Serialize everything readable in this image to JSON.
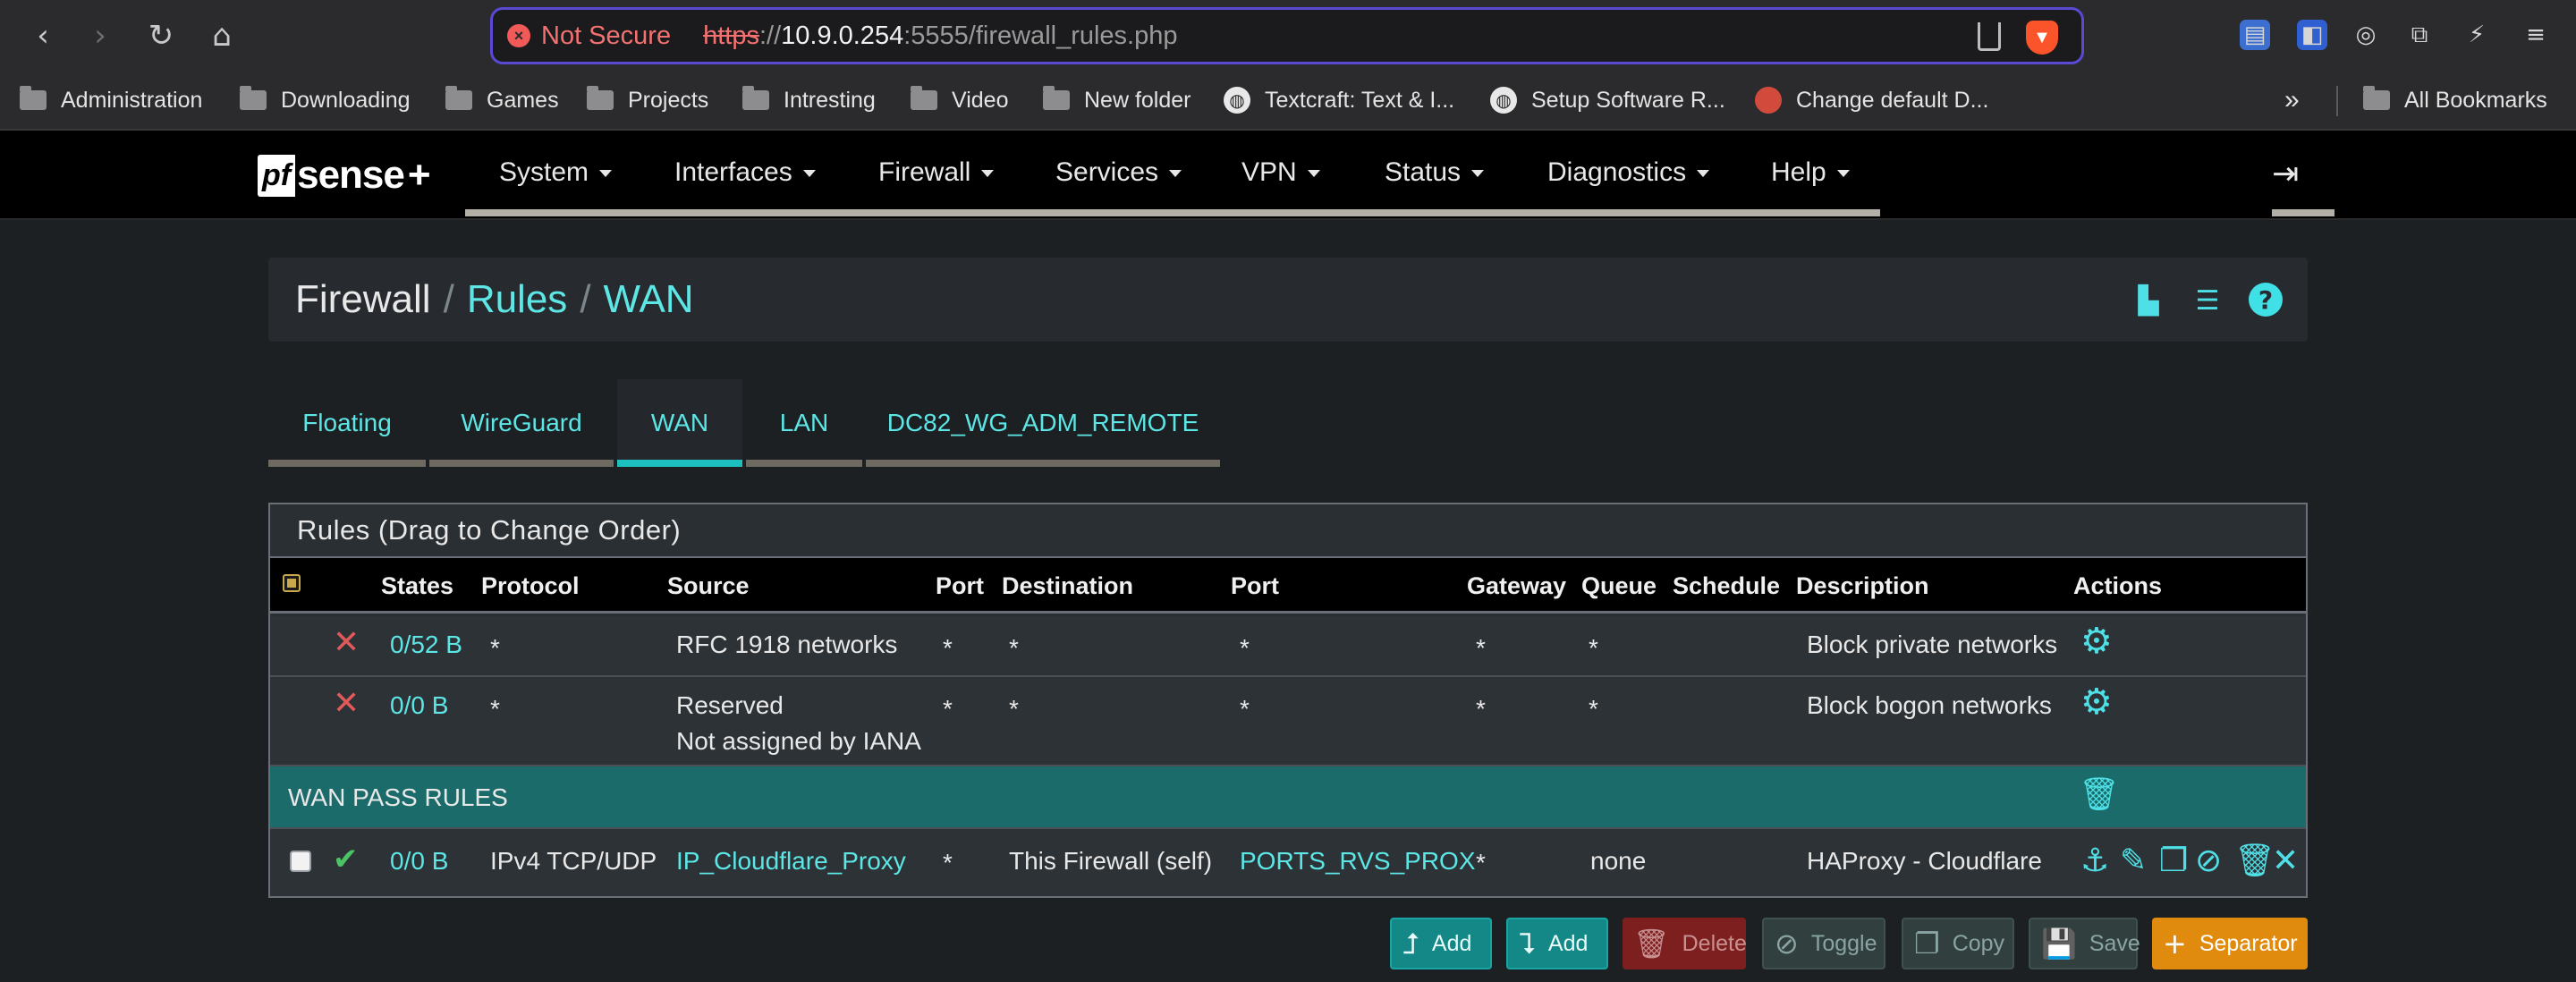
{
  "browser": {
    "security_label": "Not Secure",
    "url_scheme": "https",
    "url_sep": "://",
    "url_host": "10.9.0.254",
    "url_rest": ":5555/firewall_rules.php",
    "bookmarks": [
      "Administration",
      "Downloading",
      "Games",
      "Projects",
      "Intresting",
      "Video",
      "New folder",
      "Textcraft: Text & I...",
      "Setup Software R...",
      "Change default D...",
      "All Bookmarks"
    ],
    "bookmarks_more": "»"
  },
  "nav": {
    "logo_pf": "pf",
    "logo_sense": "sense",
    "logo_plus": "+",
    "menu": [
      "System",
      "Interfaces",
      "Firewall",
      "Services",
      "VPN",
      "Status",
      "Diagnostics",
      "Help"
    ]
  },
  "breadcrumb": {
    "root": "Firewall",
    "sep": "/",
    "level1": "Rules",
    "level2": "WAN"
  },
  "tabs": [
    "Floating",
    "WireGuard",
    "WAN",
    "LAN",
    "DC82_WG_ADM_REMOTE"
  ],
  "active_tab": "WAN",
  "panel": {
    "title": "Rules (Drag to Change Order)",
    "headers": [
      "States",
      "Protocol",
      "Source",
      "Port",
      "Destination",
      "Port",
      "Gateway",
      "Queue",
      "Schedule",
      "Description",
      "Actions"
    ]
  },
  "rules": [
    {
      "states": "0/52 B",
      "protocol": "*",
      "source": "RFC 1918 networks",
      "source2": "",
      "sport": "*",
      "dest": "*",
      "dport": "*",
      "gateway": "*",
      "queue": "*",
      "schedule": "",
      "description": "Block private networks"
    },
    {
      "states": "0/0 B",
      "protocol": "*",
      "source": "Reserved",
      "source2": "Not assigned by IANA",
      "sport": "*",
      "dest": "*",
      "dport": "*",
      "gateway": "*",
      "queue": "*",
      "schedule": "",
      "description": "Block bogon networks"
    }
  ],
  "separator": {
    "label": "WAN PASS RULES"
  },
  "pass_rule": {
    "states": "0/0 B",
    "protocol": "IPv4 TCP/UDP",
    "source": "IP_Cloudflare_Proxy",
    "sport": "*",
    "dest": "This Firewall (self)",
    "dport": "PORTS_RVS_PROX",
    "gateway": "*",
    "queue": "none",
    "schedule": "",
    "description": "HAProxy - Cloudflare"
  },
  "buttons": {
    "add_top": "Add",
    "add_bottom": "Add",
    "delete": "Delete",
    "toggle": "Toggle",
    "copy": "Copy",
    "save": "Save",
    "separator": "Separator"
  },
  "colors": {
    "accent": "#5de6e6",
    "separator_row": "#1b6b6b",
    "block": "#e05a5a",
    "pass": "#4cc466",
    "separator_button": "#e08b0e"
  }
}
